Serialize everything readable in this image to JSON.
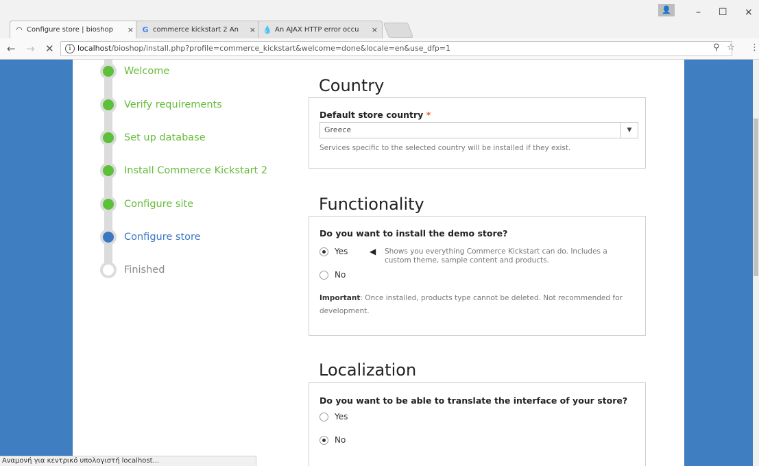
{
  "browser": {
    "tabs": [
      {
        "label": "Configure store | bioshop",
        "icon": "loading-icon",
        "close": "×"
      },
      {
        "label": "commerce kickstart 2 An",
        "icon": "google-icon",
        "close": "×"
      },
      {
        "label": "An AJAX HTTP error occu",
        "icon": "drupal-icon",
        "close": "×"
      }
    ],
    "window_controls": {
      "minimize": "–",
      "maximize": "☐",
      "close": "×"
    },
    "url_host": "localhost",
    "url_path": "/bioshop/install.php?profile=commerce_kickstart&welcome=done&locale=en&use_dfp=1",
    "status_text": "Αναμονή για κεντρικό υπολογιστή localhost..."
  },
  "steps": [
    {
      "label": "Welcome",
      "state": "done"
    },
    {
      "label": "Verify requirements",
      "state": "done"
    },
    {
      "label": "Set up database",
      "state": "done"
    },
    {
      "label": "Install Commerce Kickstart 2",
      "state": "done"
    },
    {
      "label": "Configure site",
      "state": "done"
    },
    {
      "label": "Configure store",
      "state": "active"
    },
    {
      "label": "Finished",
      "state": "todo"
    }
  ],
  "country": {
    "title": "Country",
    "field_label": "Default store country",
    "required_mark": "*",
    "selected": "Greece",
    "description": "Services specific to the selected country will be installed if they exist."
  },
  "functionality": {
    "title": "Functionality",
    "question": "Do you want to install the demo store?",
    "yes_label": "Yes",
    "yes_desc_line1": "Shows you everything Commerce Kickstart can do. Includes a",
    "yes_desc_line2": "custom theme, sample content and products.",
    "no_label": "No",
    "selected": "Yes",
    "note_bold": "Important",
    "note_text_line1": ": Once installed, products type cannot be deleted. Not recommended for",
    "note_text_line2": "development."
  },
  "localization": {
    "title": "Localization",
    "question": "Do you want to be able to translate the interface of your store?",
    "yes_label": "Yes",
    "no_label": "No",
    "selected": "No"
  }
}
